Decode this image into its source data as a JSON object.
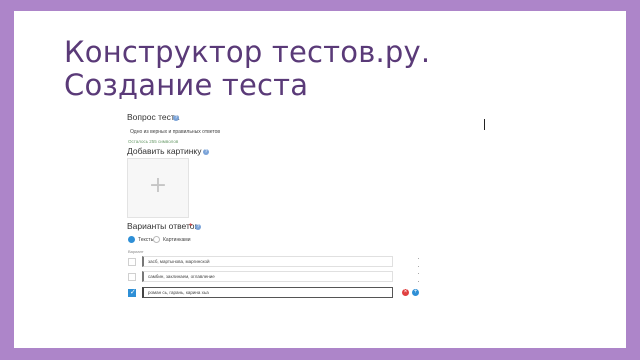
{
  "slide": {
    "title_line1": "Конструктор тестов.ру.",
    "title_line2": "Создание теста"
  },
  "screenshot": {
    "question_label": "Вопрос теста",
    "question_value": "Одно из верных и правильных ответов",
    "question_hint": "Осталось 255 символов",
    "add_image_label": "Добавить картинку",
    "add_image_plus": "+",
    "answers_label": "Варианты ответов",
    "required_mark": "*",
    "mode_text": "Тексты",
    "mode_images": "Картинками",
    "answers_caption": "Вариант",
    "answers": [
      {
        "text": "засб, мартынова, маргинской",
        "checked": false
      },
      {
        "text": "самбин, заклинаем, оглавление",
        "checked": false
      },
      {
        "text": "роман сь, гарань, карина хьа",
        "checked": true
      }
    ],
    "help_glyph": "?",
    "delete_glyph": "×",
    "add_glyph": "+"
  }
}
